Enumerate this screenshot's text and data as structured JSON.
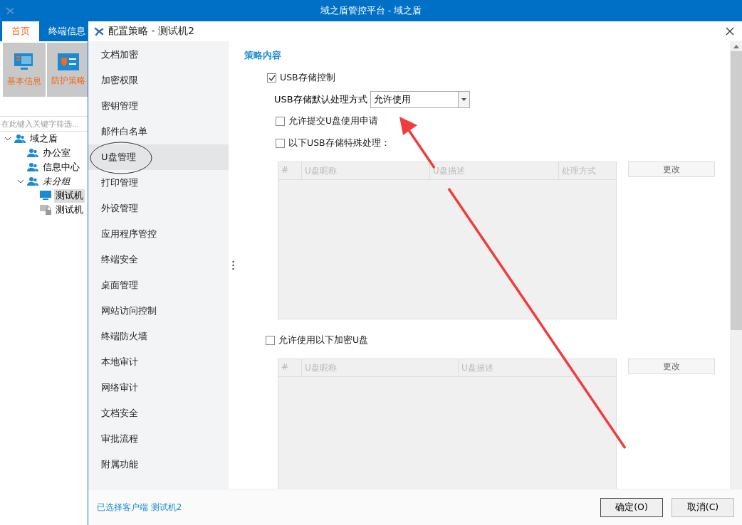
{
  "app": {
    "title": "域之盾管控平台 - 域之盾",
    "tabs": [
      {
        "label": "首页",
        "selected": true
      },
      {
        "label": "终端信息",
        "selected": false
      }
    ],
    "tiles": [
      {
        "label": "基本信息",
        "kind": "info"
      },
      {
        "label": "防护策略",
        "kind": "policy"
      }
    ],
    "search": {
      "placeholder": "在此键入关键字筛选..."
    },
    "tree": [
      {
        "label": "域之盾",
        "kind": "group",
        "expanded": true,
        "selected": false,
        "children": [
          {
            "label": "办公室",
            "kind": "group",
            "selected": false
          },
          {
            "label": "信息中心",
            "kind": "group",
            "selected": false
          },
          {
            "label": "未分组",
            "kind": "ungrouped",
            "expanded": true,
            "selected": false,
            "children": [
              {
                "label": "测试机",
                "kind": "online",
                "selected": true
              },
              {
                "label": "测试机",
                "kind": "offline",
                "selected": false
              }
            ]
          }
        ]
      }
    ]
  },
  "dialog": {
    "title": "配置策略 - 测试机2",
    "nav": [
      {
        "label": "文档加密",
        "selected": false
      },
      {
        "label": "加密权限",
        "selected": false
      },
      {
        "label": "密钥管理",
        "selected": false
      },
      {
        "label": "邮件白名单",
        "selected": false
      },
      {
        "label": "U盘管理",
        "selected": true
      },
      {
        "label": "打印管理",
        "selected": false
      },
      {
        "label": "外设管理",
        "selected": false
      },
      {
        "label": "应用程序管控",
        "selected": false
      },
      {
        "label": "终端安全",
        "selected": false
      },
      {
        "label": "桌面管理",
        "selected": false
      },
      {
        "label": "网站访问控制",
        "selected": false
      },
      {
        "label": "终端防火墙",
        "selected": false
      },
      {
        "label": "本地审计",
        "selected": false
      },
      {
        "label": "网络审计",
        "selected": false
      },
      {
        "label": "文档安全",
        "selected": false
      },
      {
        "label": "审批流程",
        "selected": false
      },
      {
        "label": "附属功能",
        "selected": false
      }
    ],
    "heading": "策略内容",
    "usb_control": {
      "label": "USB存储控制",
      "checked": true
    },
    "default_mode": {
      "label": "USB存储默认处理方式",
      "value": "允许使用"
    },
    "allow_request": {
      "label": "允许提交U盘使用申请",
      "checked": false
    },
    "special": {
      "label": "以下USB存储特殊处理：",
      "checked": false
    },
    "special_table": {
      "columns": [
        "#",
        "U盘昵称",
        "U盘描述",
        "处理方式"
      ],
      "button": "更改"
    },
    "encrypted": {
      "label": "允许使用以下加密U盘",
      "checked": false
    },
    "encrypted_table": {
      "columns": [
        "#",
        "U盘昵称",
        "U盘描述"
      ],
      "button": "更改"
    },
    "status": "已选择客户端 测试机2",
    "buttons": [
      "确定(O)",
      "取消(C)"
    ]
  }
}
